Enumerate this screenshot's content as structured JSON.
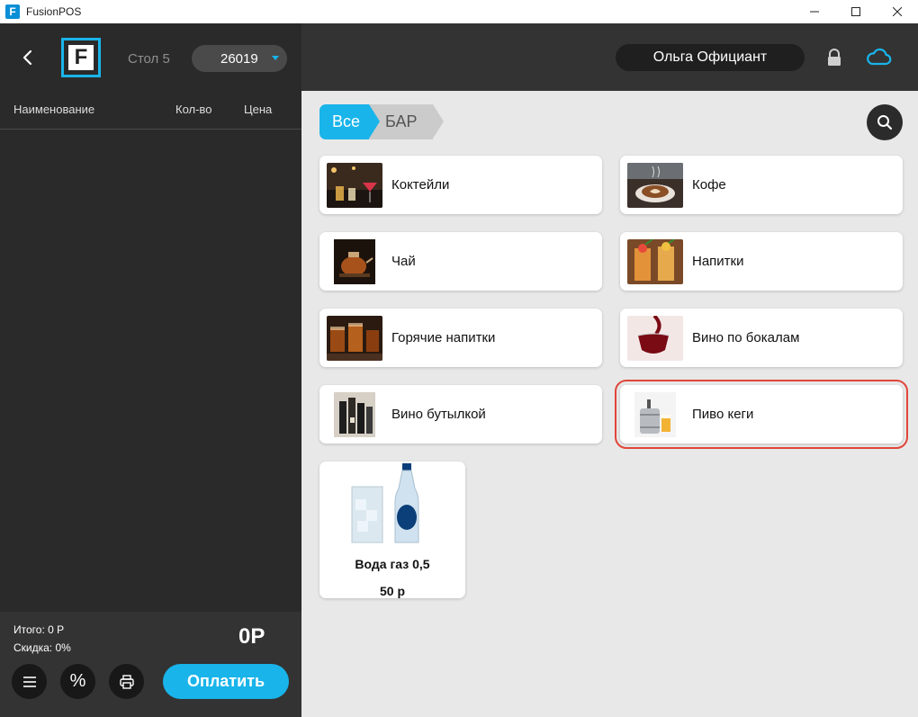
{
  "window": {
    "title": "FusionPOS",
    "logo_letter": "F"
  },
  "left": {
    "brand_letter": "F",
    "table_label": "Стол 5",
    "order_number": "26019",
    "columns": {
      "name": "Наименование",
      "qty": "Кол-во",
      "price": "Цена"
    },
    "footer": {
      "total": "Итого: 0 Р",
      "discount": "Скидка: 0%",
      "grand_total": "0Р",
      "pay_label": "Оплатить",
      "percent_glyph": "%"
    }
  },
  "header": {
    "user": "Ольга Официант"
  },
  "breadcrumbs": {
    "all": "Все",
    "bar": "БАР"
  },
  "categories": [
    {
      "label": "Коктейли"
    },
    {
      "label": "Кофе"
    },
    {
      "label": "Чай"
    },
    {
      "label": "Напитки"
    },
    {
      "label": "Горячие напитки"
    },
    {
      "label": "Вино по бокалам"
    },
    {
      "label": "Вино бутылкой"
    },
    {
      "label": "Пиво кеги"
    }
  ],
  "product": {
    "name": "Вода газ 0,5",
    "price": "50 р"
  },
  "colors": {
    "accent": "#19b4ea",
    "highlight": "#e0463a",
    "panel_dark": "#2a2a2a"
  }
}
